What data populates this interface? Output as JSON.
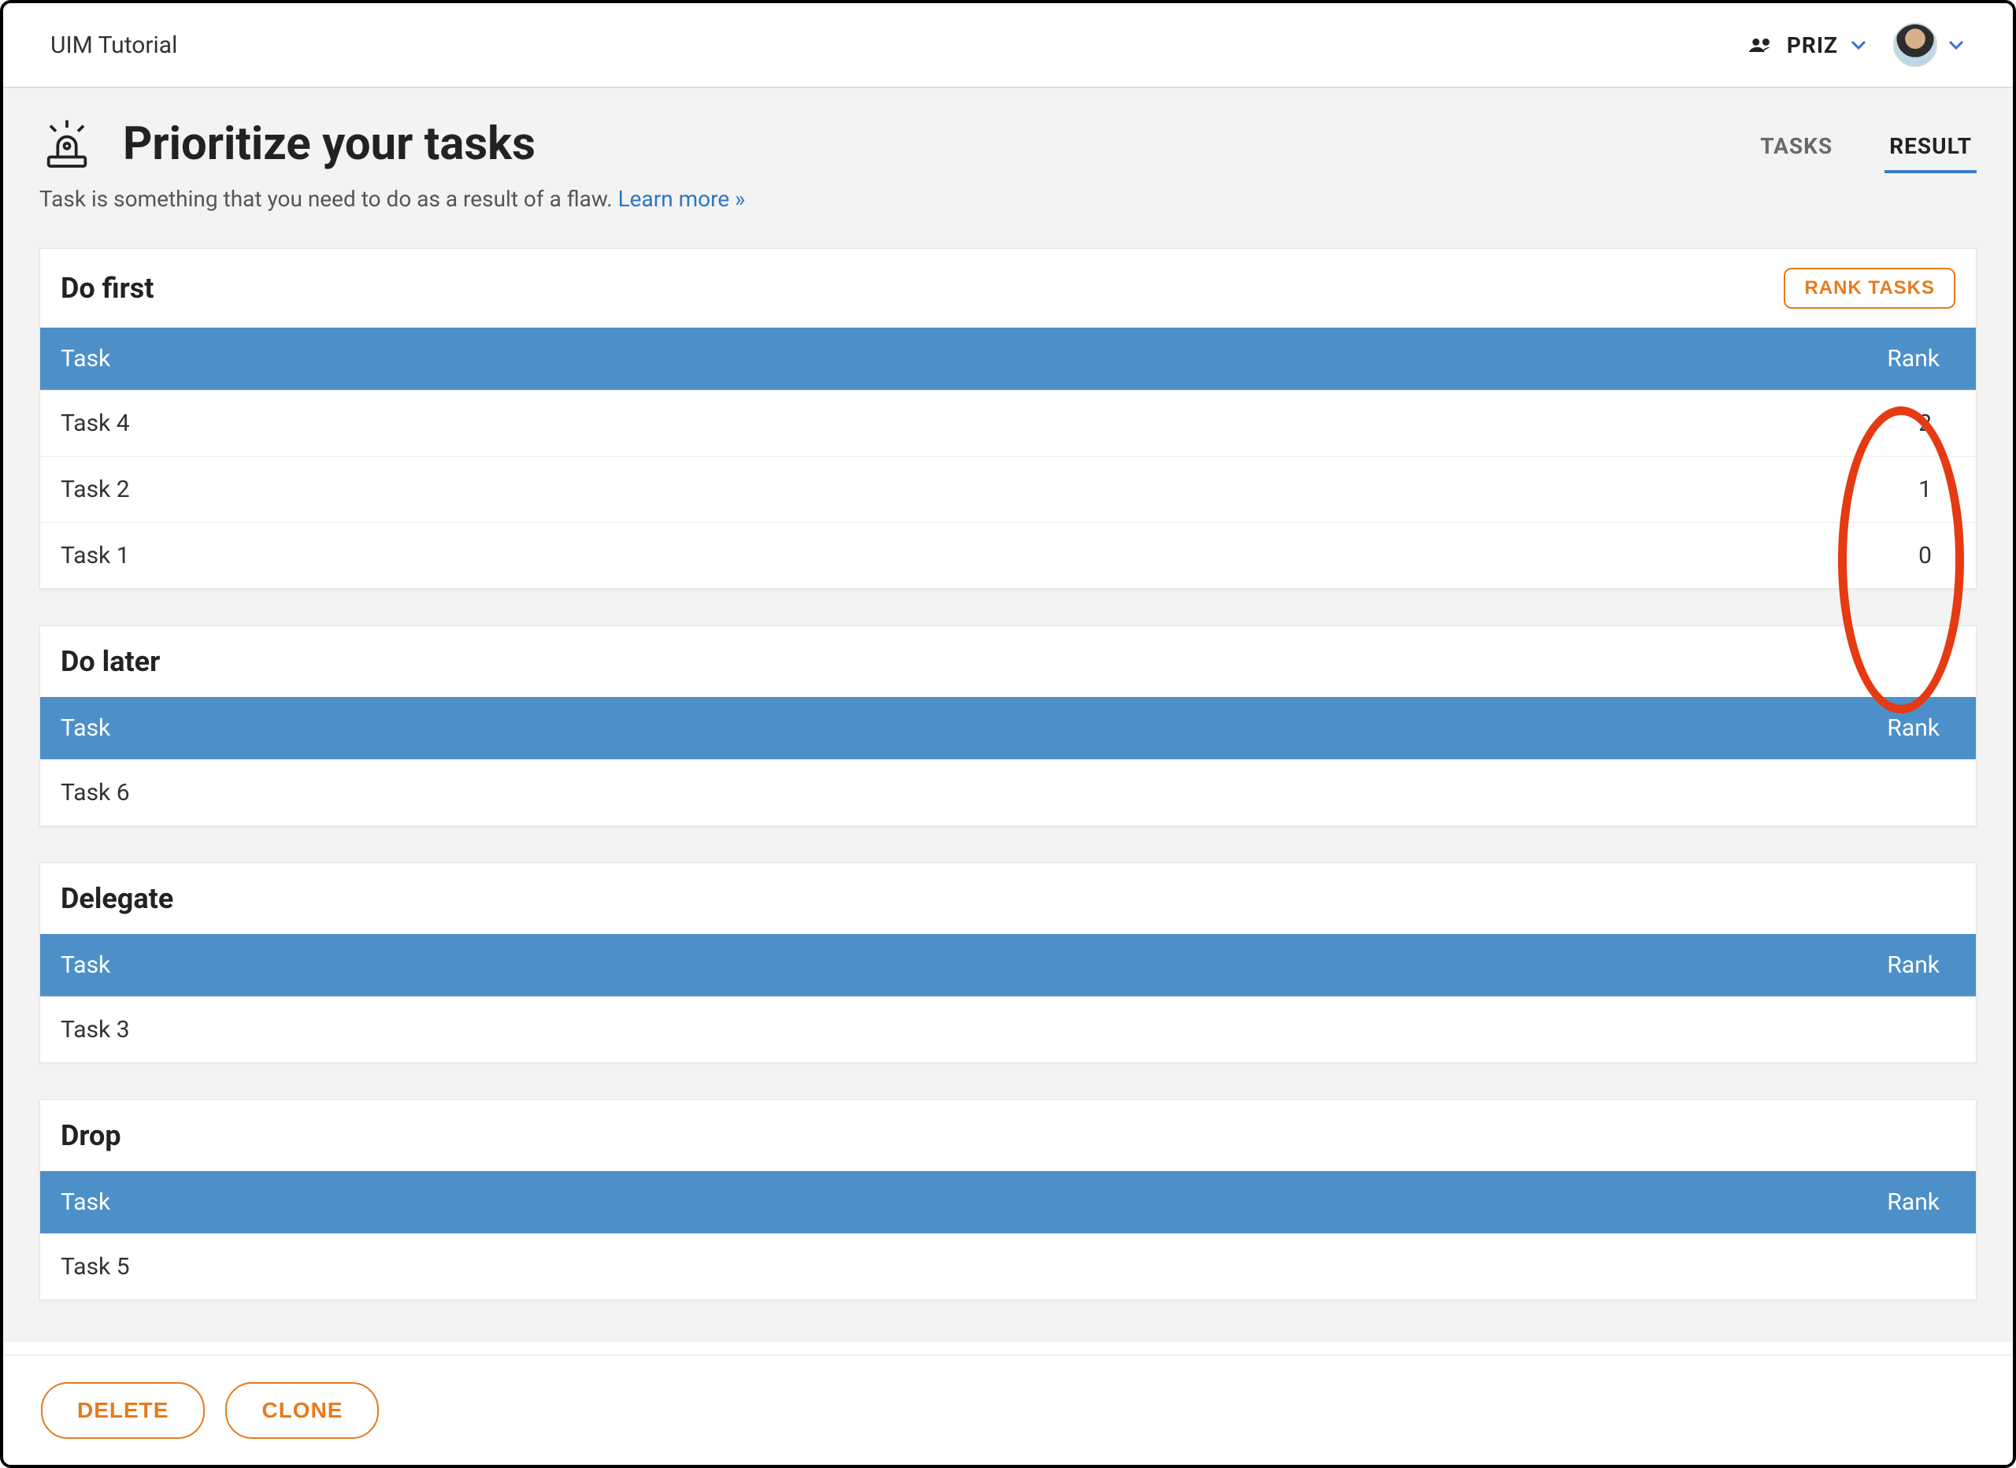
{
  "app": {
    "title": "UIM Tutorial"
  },
  "topbar": {
    "org_label": "PRIZ"
  },
  "page": {
    "title": "Prioritize your tasks",
    "subtitle": "Task is something that you need to do as a result of a flaw.",
    "learn_more": "Learn more »"
  },
  "tabs": [
    {
      "label": "TASKS",
      "active": false
    },
    {
      "label": "RESULT",
      "active": true
    }
  ],
  "table_head": {
    "task": "Task",
    "rank": "Rank"
  },
  "buttons": {
    "rank_tasks": "RANK TASKS",
    "delete": "DELETE",
    "clone": "CLONE"
  },
  "sections": {
    "do_first": {
      "title": "Do first",
      "rows": [
        {
          "task": "Task 4",
          "rank": "2"
        },
        {
          "task": "Task 2",
          "rank": "1"
        },
        {
          "task": "Task 1",
          "rank": "0"
        }
      ]
    },
    "do_later": {
      "title": "Do later",
      "rows": [
        {
          "task": "Task 6",
          "rank": ""
        }
      ]
    },
    "delegate": {
      "title": "Delegate",
      "rows": [
        {
          "task": "Task 3",
          "rank": ""
        }
      ]
    },
    "drop": {
      "title": "Drop",
      "rows": [
        {
          "task": "Task 5",
          "rank": ""
        }
      ]
    }
  }
}
